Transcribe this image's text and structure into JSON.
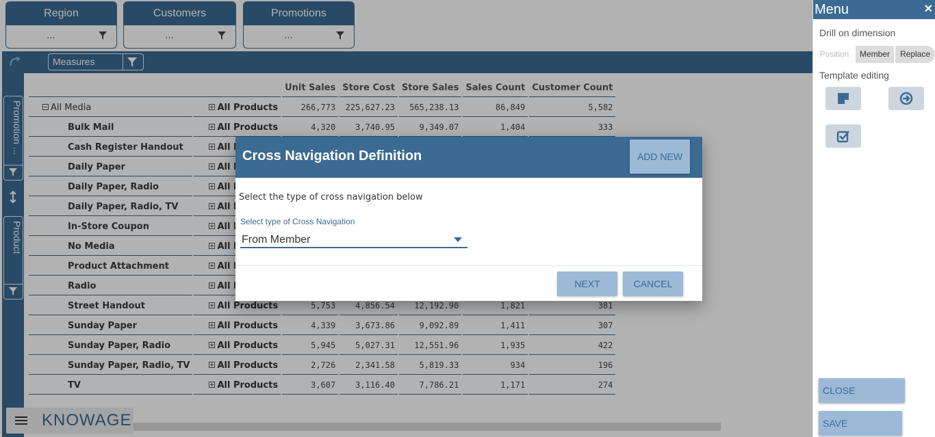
{
  "filters": [
    {
      "label": "Region",
      "value": "..."
    },
    {
      "label": "Customers",
      "value": "..."
    },
    {
      "label": "Promotions",
      "value": "..."
    }
  ],
  "toolbar": {
    "measures_label": "Measures"
  },
  "side_filters": [
    {
      "label": "Promotion ..."
    },
    {
      "label": "Product"
    }
  ],
  "table": {
    "headers": [
      "Unit Sales",
      "Store Cost",
      "Store Sales",
      "Sales Count",
      "Customer Count"
    ],
    "rows": [
      {
        "media": "All Media",
        "product": "All Products",
        "values": [
          "266,773",
          "225,627.23",
          "565,238.13",
          "86,849",
          "5,582"
        ]
      },
      {
        "media": "Bulk Mail",
        "product": "All Products",
        "values": [
          "4,320",
          "3,740.95",
          "9,349.07",
          "1,404",
          "333"
        ]
      },
      {
        "media": "Cash Register Handout",
        "product": "All Products",
        "values": [
          "",
          "",
          "",
          "",
          ""
        ]
      },
      {
        "media": "Daily Paper",
        "product": "All Products",
        "values": [
          "",
          "",
          "",
          "",
          ""
        ]
      },
      {
        "media": "Daily Paper, Radio",
        "product": "All Products",
        "values": [
          "",
          "",
          "",
          "",
          ""
        ]
      },
      {
        "media": "Daily Paper, Radio, TV",
        "product": "All Products",
        "values": [
          "",
          "",
          "",
          "",
          ""
        ]
      },
      {
        "media": "In-Store Coupon",
        "product": "All Products",
        "values": [
          "",
          "",
          "",
          "",
          ""
        ]
      },
      {
        "media": "No Media",
        "product": "All Products",
        "values": [
          "",
          "",
          "",
          "",
          ""
        ]
      },
      {
        "media": "Product Attachment",
        "product": "All Products",
        "values": [
          "",
          "",
          "",
          "",
          ""
        ]
      },
      {
        "media": "Radio",
        "product": "All Products",
        "values": [
          "",
          "",
          "",
          "",
          ""
        ]
      },
      {
        "media": "Street Handout",
        "product": "All Products",
        "values": [
          "5,753",
          "4,856.54",
          "12,192.90",
          "1,821",
          "381"
        ]
      },
      {
        "media": "Sunday Paper",
        "product": "All Products",
        "values": [
          "4,339",
          "3,673.86",
          "9,092.89",
          "1,411",
          "307"
        ]
      },
      {
        "media": "Sunday Paper, Radio",
        "product": "All Products",
        "values": [
          "5,945",
          "5,027.31",
          "12,551.96",
          "1,935",
          "422"
        ]
      },
      {
        "media": "Sunday Paper, Radio, TV",
        "product": "All Products",
        "values": [
          "2,726",
          "2,341.58",
          "5,819.33",
          "934",
          "196"
        ]
      },
      {
        "media": "TV",
        "product": "All Products",
        "values": [
          "3,607",
          "3,116.40",
          "7,786.21",
          "1,171",
          "274"
        ]
      }
    ]
  },
  "logo": {
    "text": "KNOWAGE"
  },
  "menu": {
    "title": "Menu",
    "drill_label": "Drill on dimension",
    "drill_options": [
      "Position",
      "Member",
      "Replace"
    ],
    "template_label": "Template editing",
    "close_designer": "CLOSE DESIGNER",
    "save_template": "SAVE TEMPLATE"
  },
  "dialog": {
    "title": "Cross Navigation Definition",
    "add_new": "ADD NEW",
    "prompt": "Select the type of cross navigation below",
    "select_label": "Select type of Cross Navigation",
    "select_value": "From Member",
    "next": "NEXT",
    "cancel": "CANCEL"
  },
  "colors": {
    "primary": "#3b6a93",
    "button": "#9cb9d8",
    "overlay": "rgba(0,0,0,0.30)"
  }
}
